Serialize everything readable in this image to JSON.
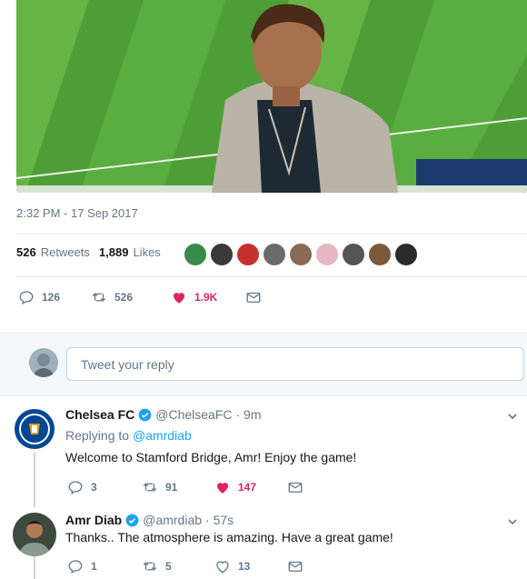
{
  "tweet": {
    "timestamp": "2:32 PM - 17 Sep 2017",
    "retweets_count": "526",
    "retweets_label": "Retweets",
    "likes_count": "1,889",
    "likes_label": "Likes",
    "actions": {
      "replies": "126",
      "retweets": "526",
      "likes": "1.9K"
    }
  },
  "reply_box": {
    "placeholder": "Tweet your reply"
  },
  "replies": [
    {
      "name": "Chelsea FC",
      "handle": "@ChelseaFC",
      "time": "· 9m",
      "replying_prefix": "Replying to",
      "replying_to": "@amrdiab",
      "text": "Welcome to Stamford Bridge, Amr! Enjoy the game!",
      "replies": "3",
      "retweets": "91",
      "likes": "147"
    },
    {
      "name": "Amr Diab",
      "handle": "@amrdiab",
      "time": "· 57s",
      "text": "Thanks.. The atmosphere is amazing. Have a great game!",
      "replies": "1",
      "retweets": "5",
      "likes": "13"
    }
  ],
  "colors": {
    "accent": "#1da1f2",
    "like": "#e0245e",
    "muted": "#657786",
    "verified": "#1da1f2"
  }
}
